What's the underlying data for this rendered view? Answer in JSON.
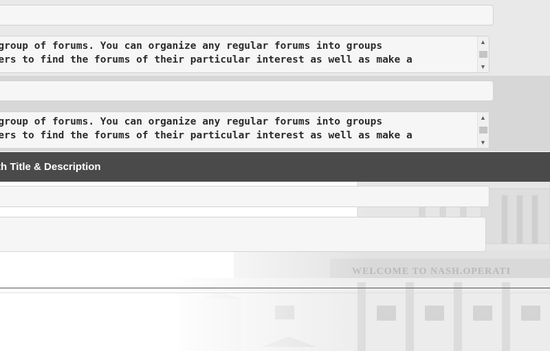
{
  "forum_category_1": {
    "title_value": "",
    "description_value": "lly a group of forums. You can organize any regular forums into groups\nfor users to find the forums of their particular interest as well as make a\n    "
  },
  "forum_category_2": {
    "title_value": "",
    "description_value": "lly a group of forums. You can organize any regular forums into groups\nfor users to find the forums of their particular interest as well as make a\n    "
  },
  "section": {
    "header": "th Title & Description"
  },
  "new_item": {
    "title_value": "",
    "description_value": ""
  },
  "backdrop": {
    "banner_text": "WELCOME TO NASH.OPERATI"
  },
  "colors": {
    "header_bg": "#4a4a4a",
    "row_bg_light": "#e9e9e9",
    "row_bg_dark": "#d7d7d7",
    "field_bg": "#f6f6f6"
  },
  "icons": [
    "scroll-up-arrow-icon",
    "scroll-down-arrow-icon"
  ]
}
